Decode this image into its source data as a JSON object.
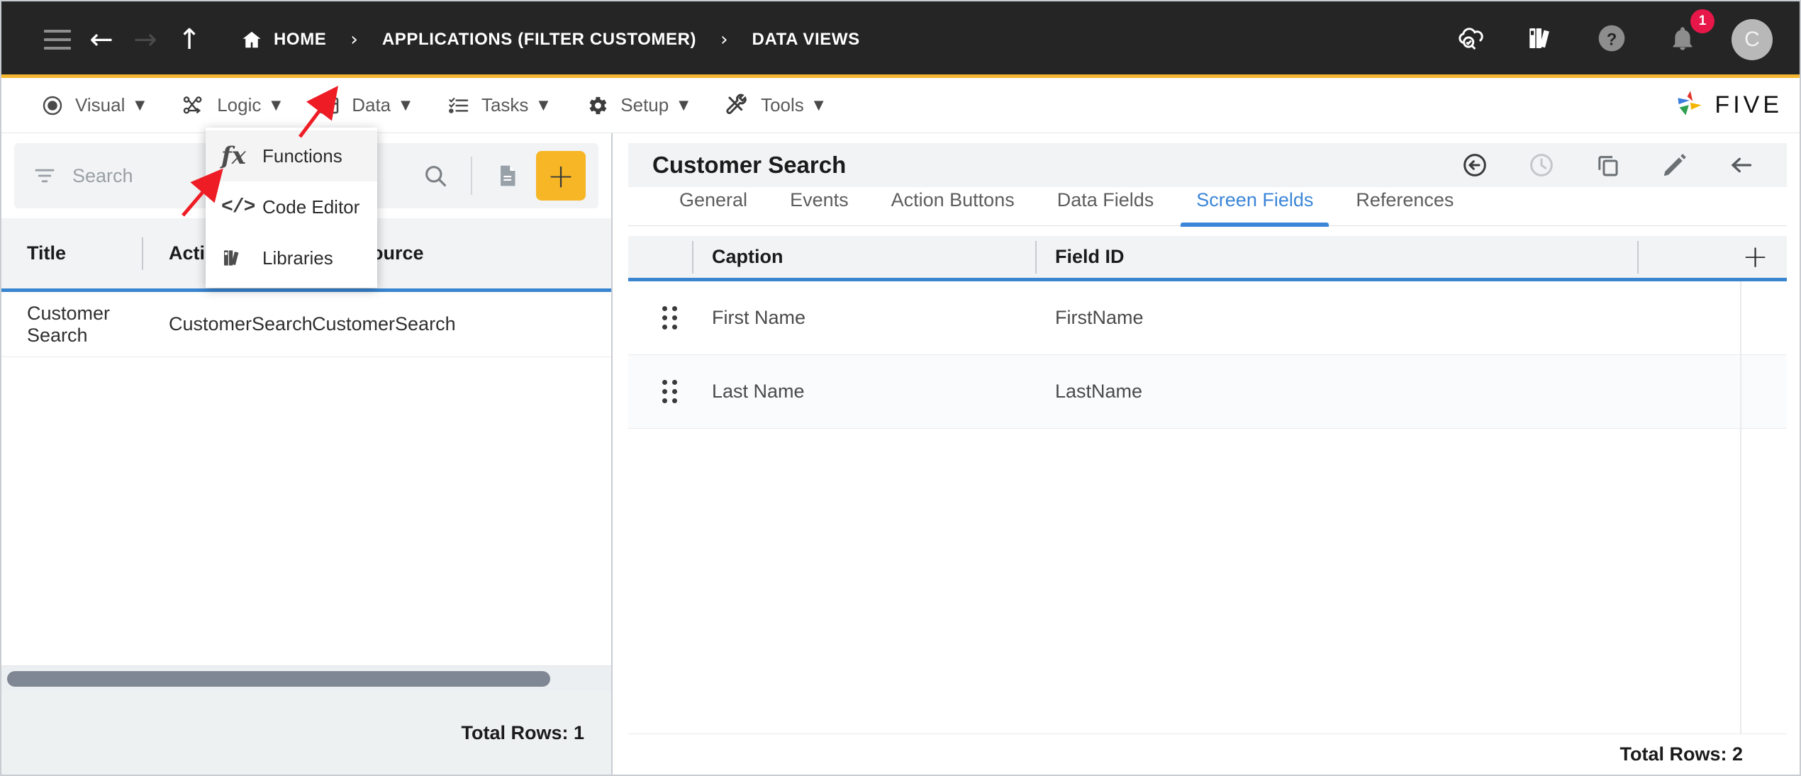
{
  "topbar": {
    "menu_icon": "hamburger-icon",
    "back_icon": "back-arrow-icon",
    "forward_icon": "forward-arrow-icon",
    "up_icon": "up-arrow-icon",
    "breadcrumbs": [
      {
        "label": "HOME",
        "icon": "home-icon"
      },
      {
        "label": "APPLICATIONS (FILTER CUSTOMER)",
        "icon": ""
      },
      {
        "label": "DATA VIEWS",
        "icon": ""
      }
    ],
    "separator": "›",
    "right_icons": [
      {
        "name": "cloud-check-icon"
      },
      {
        "name": "books-icon"
      },
      {
        "name": "help-icon"
      },
      {
        "name": "notifications-icon"
      }
    ],
    "notification_count": "1",
    "avatar_initial": "C"
  },
  "menubar": {
    "items": [
      {
        "label": "Visual",
        "icon": "eye-icon",
        "caret": "▼"
      },
      {
        "label": "Logic",
        "icon": "logic-nodes-icon",
        "caret": "▼"
      },
      {
        "label": "Data",
        "icon": "table-grid-icon",
        "caret": "▼"
      },
      {
        "label": "Tasks",
        "icon": "checklist-icon",
        "caret": "▼"
      },
      {
        "label": "Setup",
        "icon": "gear-icon",
        "caret": "▼"
      },
      {
        "label": "Tools",
        "icon": "tools-icon",
        "caret": "▼"
      }
    ],
    "logo_text": "FIVE"
  },
  "dropdown": {
    "open_for": "Logic",
    "items": [
      {
        "label": "Functions",
        "icon": "fx-icon",
        "active": true
      },
      {
        "label": "Code Editor",
        "icon": "code-brackets-icon",
        "active": false
      },
      {
        "label": "Libraries",
        "icon": "books-icon",
        "active": false
      }
    ]
  },
  "left_panel": {
    "toolbar": {
      "filter_icon": "filter-icon",
      "search_placeholder": "Search",
      "search_value": "",
      "search_icon": "search-icon",
      "document_icon": "document-icon",
      "add_label": "+"
    },
    "table": {
      "columns": [
        "Title",
        "Action ID",
        "Data Source"
      ],
      "rows": [
        {
          "title": "Customer Search",
          "action_id": "CustomerSearch",
          "data_source": "CustomerSearch"
        }
      ]
    },
    "footer_total": "Total Rows: 1"
  },
  "right_panel": {
    "title": "Customer Search",
    "action_icons": [
      {
        "name": "undo-circle-icon"
      },
      {
        "name": "history-clock-icon"
      },
      {
        "name": "copy-icon"
      },
      {
        "name": "edit-pencil-icon"
      },
      {
        "name": "back-arrow-icon"
      }
    ],
    "tabs": [
      {
        "label": "General",
        "active": false
      },
      {
        "label": "Events",
        "active": false
      },
      {
        "label": "Action Buttons",
        "active": false
      },
      {
        "label": "Data Fields",
        "active": false
      },
      {
        "label": "Screen Fields",
        "active": true
      },
      {
        "label": "References",
        "active": false
      }
    ],
    "table": {
      "columns": [
        "Caption",
        "Field ID"
      ],
      "add_label": "+",
      "rows": [
        {
          "caption": "First Name",
          "field_id": "FirstName"
        },
        {
          "caption": "Last Name",
          "field_id": "LastName"
        }
      ]
    },
    "footer_total": "Total Rows: 2"
  },
  "colors": {
    "topbar_bg": "#252525",
    "accent_yellow": "#f5b731",
    "accent_blue": "#3a85d0",
    "badge_red": "#e8174a",
    "annotation_red": "#ee1c25"
  }
}
